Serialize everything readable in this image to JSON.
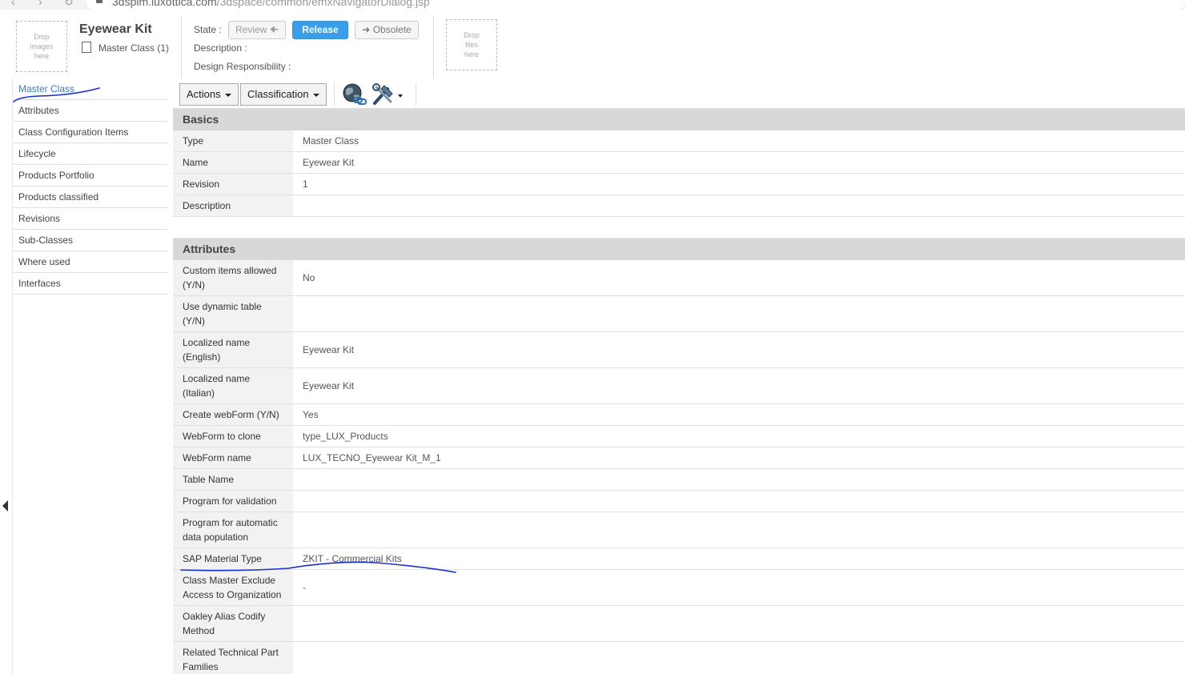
{
  "browser": {
    "url_host": "3dspim.luxottica.com",
    "url_path": "/3dspace/common/emxNavigatorDialog.jsp"
  },
  "header": {
    "drop_images": "Drop images here",
    "drop_files": "Drop files here",
    "title": "Eyewear Kit",
    "subtitle": "Master Class (1)",
    "state_label": "State :",
    "description_label": "Description :",
    "design_resp_label": "Design Responsibility :",
    "buttons": {
      "review": "Review",
      "release": "Release",
      "obsolete": "Obsolete"
    }
  },
  "sidenav": {
    "items": [
      {
        "label": "Master Class",
        "active": true
      },
      {
        "label": "Attributes"
      },
      {
        "label": "Class Configuration Items"
      },
      {
        "label": "Lifecycle"
      },
      {
        "label": "Products Portfolio"
      },
      {
        "label": "Products classified"
      },
      {
        "label": "Revisions"
      },
      {
        "label": "Sub-Classes"
      },
      {
        "label": "Where used"
      },
      {
        "label": "Interfaces"
      }
    ]
  },
  "toolbar": {
    "actions": "Actions",
    "classification": "Classification"
  },
  "basics": {
    "title": "Basics",
    "rows": [
      {
        "label": "Type",
        "value": "Master Class"
      },
      {
        "label": "Name",
        "value": "Eyewear Kit"
      },
      {
        "label": "Revision",
        "value": "1"
      },
      {
        "label": "Description",
        "value": ""
      }
    ]
  },
  "attributes": {
    "title": "Attributes",
    "rows": [
      {
        "label": "Custom items allowed (Y/N)",
        "value": "No"
      },
      {
        "label": "Use dynamic table (Y/N)",
        "value": ""
      },
      {
        "label": "Localized name (English)",
        "value": "Eyewear Kit"
      },
      {
        "label": "Localized name (Italian)",
        "value": "Eyewear Kit"
      },
      {
        "label": "Create webForm (Y/N)",
        "value": "Yes"
      },
      {
        "label": "WebForm to clone",
        "value": "type_LUX_Products"
      },
      {
        "label": "WebForm name",
        "value": "LUX_TECNO_Eyewear Kit_M_1"
      },
      {
        "label": "Table Name",
        "value": ""
      },
      {
        "label": "Program for validation",
        "value": ""
      },
      {
        "label": "Program for automatic data population",
        "value": ""
      },
      {
        "label": "SAP Material Type",
        "value": "ZKIT - Commercial Kits"
      },
      {
        "label": "Class Master Exclude Access to Organization",
        "value": "-"
      },
      {
        "label": "Oakley Alias Codify Method",
        "value": ""
      },
      {
        "label": "Related Technical Part Families",
        "value": ""
      }
    ]
  },
  "colors": {
    "accent": "#3a9ee8",
    "active_link": "#3b7cc4",
    "annotation": "#1a2fc8",
    "section_bg": "#d8d8d8",
    "label_bg": "#f2f2f2"
  }
}
